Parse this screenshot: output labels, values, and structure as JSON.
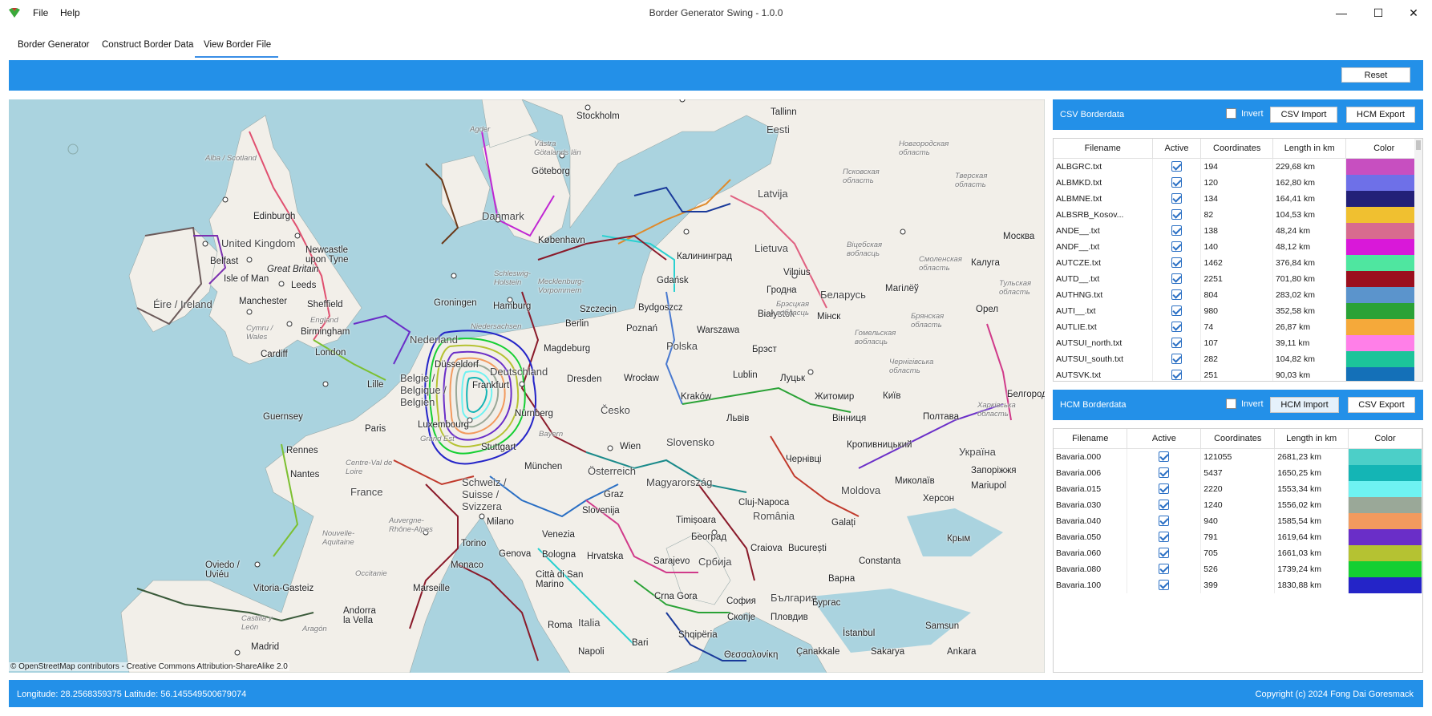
{
  "window": {
    "title": "Border Generator Swing - 1.0.0",
    "menu": [
      "File",
      "Help"
    ],
    "controls": {
      "minimize": "—",
      "maximize": "☐",
      "close": "✕"
    }
  },
  "tabs": [
    {
      "label": "Border Generator",
      "active": false
    },
    {
      "label": "Construct Border Data",
      "active": false
    },
    {
      "label": "View Border File",
      "active": true
    }
  ],
  "toolbar": {
    "reset_label": "Reset"
  },
  "map": {
    "attribution": "© OpenStreetMap contributors - Creative Commons Attribution-ShareAlike 2.0",
    "labels": [
      {
        "text": "Stockholm",
        "cls": ""
      },
      {
        "text": "Tallinn",
        "cls": ""
      },
      {
        "text": "Eesti",
        "cls": "big"
      },
      {
        "text": "Agder",
        "cls": "small"
      },
      {
        "text": "Västra Götalands län",
        "cls": "small"
      },
      {
        "text": "Göteborg",
        "cls": ""
      },
      {
        "text": "Latvija",
        "cls": "big"
      },
      {
        "text": "Псковская область",
        "cls": "small"
      },
      {
        "text": "Новгородская область",
        "cls": "small"
      },
      {
        "text": "Тверская область",
        "cls": "small"
      },
      {
        "text": "Москва",
        "cls": ""
      },
      {
        "text": "Danmark",
        "cls": "big"
      },
      {
        "text": "København",
        "cls": ""
      },
      {
        "text": "Alba / Scotland",
        "cls": "small"
      },
      {
        "text": "Edinburgh",
        "cls": ""
      },
      {
        "text": "United Kingdom",
        "cls": "big"
      },
      {
        "text": "Newcastle upon Tyne",
        "cls": ""
      },
      {
        "text": "Belfast",
        "cls": ""
      },
      {
        "text": "Isle of Man",
        "cls": ""
      },
      {
        "text": "Great Britain",
        "cls": ""
      },
      {
        "text": "Leeds",
        "cls": ""
      },
      {
        "text": "Manchester",
        "cls": ""
      },
      {
        "text": "Sheffield",
        "cls": ""
      },
      {
        "text": "Éire / Ireland",
        "cls": "big"
      },
      {
        "text": "England",
        "cls": "small"
      },
      {
        "text": "Birmingham",
        "cls": ""
      },
      {
        "text": "Cymru / Wales",
        "cls": "small"
      },
      {
        "text": "Cardiff",
        "cls": ""
      },
      {
        "text": "London",
        "cls": ""
      },
      {
        "text": "Hamburg",
        "cls": ""
      },
      {
        "text": "Groningen",
        "cls": ""
      },
      {
        "text": "Schleswig-Holstein",
        "cls": "small"
      },
      {
        "text": "Mecklenburg-Vorpommern",
        "cls": "small"
      },
      {
        "text": "Калининград",
        "cls": ""
      },
      {
        "text": "Lietuva",
        "cls": "big"
      },
      {
        "text": "Vilnius",
        "cls": ""
      },
      {
        "text": "Вiцебская вобласць",
        "cls": "small"
      },
      {
        "text": "Смоленская область",
        "cls": "small"
      },
      {
        "text": "Калуга",
        "cls": ""
      },
      {
        "text": "Gdańsk",
        "cls": ""
      },
      {
        "text": "Bydgoszcz",
        "cls": ""
      },
      {
        "text": "Szczecin",
        "cls": ""
      },
      {
        "text": "Niedersachsen",
        "cls": "small"
      },
      {
        "text": "Nederland",
        "cls": "big"
      },
      {
        "text": "Berlin",
        "cls": ""
      },
      {
        "text": "Poznań",
        "cls": ""
      },
      {
        "text": "Warszawa",
        "cls": ""
      },
      {
        "text": "Białystok",
        "cls": ""
      },
      {
        "text": "Гродна",
        "cls": ""
      },
      {
        "text": "Беларусь",
        "cls": "big"
      },
      {
        "text": "Мінск",
        "cls": ""
      },
      {
        "text": "Магілёў",
        "cls": ""
      },
      {
        "text": "Брянская область",
        "cls": "small"
      },
      {
        "text": "Тульская область",
        "cls": "small"
      },
      {
        "text": "Орел",
        "cls": ""
      },
      {
        "text": "Magdeburg",
        "cls": ""
      },
      {
        "text": "Polska",
        "cls": "big"
      },
      {
        "text": "Брэсцкая вобласць",
        "cls": "small"
      },
      {
        "text": "Гомельская вобласць",
        "cls": "small"
      },
      {
        "text": "Брэст",
        "cls": ""
      },
      {
        "text": "Düsseldorf",
        "cls": ""
      },
      {
        "text": "Deutschland",
        "cls": "big"
      },
      {
        "text": "Dresden",
        "cls": ""
      },
      {
        "text": "Wrocław",
        "cls": ""
      },
      {
        "text": "Lublin",
        "cls": ""
      },
      {
        "text": "Луцьк",
        "cls": ""
      },
      {
        "text": "Чернігівська область",
        "cls": "small"
      },
      {
        "text": "Belgie / Belgique / Belgien",
        "cls": "big"
      },
      {
        "text": "Lille",
        "cls": ""
      },
      {
        "text": "Frankfurt",
        "cls": ""
      },
      {
        "text": "Česko",
        "cls": "big"
      },
      {
        "text": "Kraków",
        "cls": ""
      },
      {
        "text": "Житомир",
        "cls": ""
      },
      {
        "text": "Київ",
        "cls": ""
      },
      {
        "text": "Белгород",
        "cls": ""
      },
      {
        "text": "Guernsey",
        "cls": ""
      },
      {
        "text": "Nürnberg",
        "cls": ""
      },
      {
        "text": "Львів",
        "cls": ""
      },
      {
        "text": "Вінниця",
        "cls": ""
      },
      {
        "text": "Полтава",
        "cls": ""
      },
      {
        "text": "Харківська область",
        "cls": "small"
      },
      {
        "text": "Paris",
        "cls": ""
      },
      {
        "text": "Luxembourg",
        "cls": ""
      },
      {
        "text": "Bayern",
        "cls": "small"
      },
      {
        "text": "Grand Est",
        "cls": "small"
      },
      {
        "text": "Slovensko",
        "cls": "big"
      },
      {
        "text": "Кропивницький",
        "cls": ""
      },
      {
        "text": "Україна",
        "cls": "big"
      },
      {
        "text": "Rennes",
        "cls": ""
      },
      {
        "text": "Wien",
        "cls": ""
      },
      {
        "text": "Stuttgart",
        "cls": ""
      },
      {
        "text": "München",
        "cls": ""
      },
      {
        "text": "Чернівці",
        "cls": ""
      },
      {
        "text": "Österreich",
        "cls": "big"
      },
      {
        "text": "Magyarország",
        "cls": "big"
      },
      {
        "text": "Nantes",
        "cls": ""
      },
      {
        "text": "Centre-Val de Loire",
        "cls": "small"
      },
      {
        "text": "Schweiz / Suisse / Svizzera",
        "cls": "big"
      },
      {
        "text": "Миколаїв",
        "cls": ""
      },
      {
        "text": "Запоріжжя",
        "cls": ""
      },
      {
        "text": "France",
        "cls": "big"
      },
      {
        "text": "Graz",
        "cls": ""
      },
      {
        "text": "Cluj-Napoca",
        "cls": ""
      },
      {
        "text": "Moldova",
        "cls": "big"
      },
      {
        "text": "Херсон",
        "cls": ""
      },
      {
        "text": "Mariupol",
        "cls": ""
      },
      {
        "text": "Slovenija",
        "cls": ""
      },
      {
        "text": "România",
        "cls": "big"
      },
      {
        "text": "Milano",
        "cls": ""
      },
      {
        "text": "Auvergne-Rhône-Alpes",
        "cls": "small"
      },
      {
        "text": "Nouvelle-Aquitaine",
        "cls": "small"
      },
      {
        "text": "Timișoara",
        "cls": ""
      },
      {
        "text": "Galați",
        "cls": ""
      },
      {
        "text": "Venezia",
        "cls": ""
      },
      {
        "text": "Torino",
        "cls": ""
      },
      {
        "text": "Београд",
        "cls": ""
      },
      {
        "text": "Genova",
        "cls": ""
      },
      {
        "text": "Bologna",
        "cls": ""
      },
      {
        "text": "Hrvatska",
        "cls": ""
      },
      {
        "text": "Craiova",
        "cls": ""
      },
      {
        "text": "București",
        "cls": ""
      },
      {
        "text": "Constanta",
        "cls": ""
      },
      {
        "text": "Крым",
        "cls": ""
      },
      {
        "text": "Oviedo / Uviéu",
        "cls": ""
      },
      {
        "text": "Monaco",
        "cls": ""
      },
      {
        "text": "Sarajevo",
        "cls": ""
      },
      {
        "text": "Србија",
        "cls": "big"
      },
      {
        "text": "Occitanie",
        "cls": "small"
      },
      {
        "text": "Città di San Marino",
        "cls": ""
      },
      {
        "text": "Vitoria-Gasteiz",
        "cls": ""
      },
      {
        "text": "Marseille",
        "cls": ""
      },
      {
        "text": "Варна",
        "cls": ""
      },
      {
        "text": "София",
        "cls": ""
      },
      {
        "text": "България",
        "cls": "big"
      },
      {
        "text": "Crna Gora",
        "cls": ""
      },
      {
        "text": "Бургас",
        "cls": ""
      },
      {
        "text": "Andorra la Vella",
        "cls": ""
      },
      {
        "text": "Castilla y León",
        "cls": "small"
      },
      {
        "text": "Aragón",
        "cls": "small"
      },
      {
        "text": "Italia",
        "cls": "big"
      },
      {
        "text": "Roma",
        "cls": ""
      },
      {
        "text": "Скопје",
        "cls": ""
      },
      {
        "text": "Пловдив",
        "cls": ""
      },
      {
        "text": "Samsun",
        "cls": ""
      },
      {
        "text": "İstanbul",
        "cls": ""
      },
      {
        "text": "Madrid",
        "cls": ""
      },
      {
        "text": "Shqipëria",
        "cls": ""
      },
      {
        "text": "Napoli",
        "cls": ""
      },
      {
        "text": "Bari",
        "cls": ""
      },
      {
        "text": "Θεσσαλονίκη",
        "cls": ""
      },
      {
        "text": "Çanakkale",
        "cls": ""
      },
      {
        "text": "Sakarya",
        "cls": ""
      },
      {
        "text": "Ankara",
        "cls": ""
      }
    ]
  },
  "csv_panel": {
    "title": "CSV Borderdata",
    "invert_label": "Invert",
    "import_label": "CSV Import",
    "export_label": "HCM Export",
    "columns": [
      "Filename",
      "Active",
      "Coordinates",
      "Length in km",
      "Color"
    ],
    "rows": [
      {
        "filename": "ALBGRC.txt",
        "coordinates": "194",
        "length": "229,68 km",
        "color": "#c74fc0"
      },
      {
        "filename": "ALBMKD.txt",
        "coordinates": "120",
        "length": "162,80 km",
        "color": "#6e70e8"
      },
      {
        "filename": "ALBMNE.txt",
        "coordinates": "134",
        "length": "164,41 km",
        "color": "#232078"
      },
      {
        "filename": "ALBSRB_Kosov...",
        "coordinates": "82",
        "length": "104,53 km",
        "color": "#f0c030"
      },
      {
        "filename": "ANDE__.txt",
        "coordinates": "138",
        "length": "48,24 km",
        "color": "#d86b8e"
      },
      {
        "filename": "ANDF__.txt",
        "coordinates": "140",
        "length": "48,12 km",
        "color": "#d918d9"
      },
      {
        "filename": "AUTCZE.txt",
        "coordinates": "1462",
        "length": "376,84 km",
        "color": "#4fe6a0"
      },
      {
        "filename": "AUTD__.txt",
        "coordinates": "2251",
        "length": "701,80 km",
        "color": "#9b0f1e"
      },
      {
        "filename": "AUTHNG.txt",
        "coordinates": "804",
        "length": "283,02 km",
        "color": "#5b94cc"
      },
      {
        "filename": "AUTI__.txt",
        "coordinates": "980",
        "length": "352,58 km",
        "color": "#2aa236"
      },
      {
        "filename": "AUTLIE.txt",
        "coordinates": "74",
        "length": "26,87 km",
        "color": "#f5a93a"
      },
      {
        "filename": "AUTSUI_north.txt",
        "coordinates": "107",
        "length": "39,11 km",
        "color": "#ff7fe8"
      },
      {
        "filename": "AUTSUI_south.txt",
        "coordinates": "282",
        "length": "104,82 km",
        "color": "#1cc49a"
      },
      {
        "filename": "AUTSVK.txt",
        "coordinates": "251",
        "length": "90,03 km",
        "color": "#1470b8"
      }
    ]
  },
  "hcm_panel": {
    "title": "HCM Borderdata",
    "invert_label": "Invert",
    "import_label": "HCM Import",
    "export_label": "CSV Export",
    "columns": [
      "Filename",
      "Active",
      "Coordinates",
      "Length in km",
      "Color"
    ],
    "rows": [
      {
        "filename": "Bavaria.000",
        "coordinates": "121055",
        "length": "2681,23 km",
        "color": "#4ccfc8"
      },
      {
        "filename": "Bavaria.006",
        "coordinates": "5437",
        "length": "1650,25 km",
        "color": "#14b5b5"
      },
      {
        "filename": "Bavaria.015",
        "coordinates": "2220",
        "length": "1553,34 km",
        "color": "#6ef2f2"
      },
      {
        "filename": "Bavaria.030",
        "coordinates": "1240",
        "length": "1556,02 km",
        "color": "#9aa898"
      },
      {
        "filename": "Bavaria.040",
        "coordinates": "940",
        "length": "1585,54 km",
        "color": "#f29a5e"
      },
      {
        "filename": "Bavaria.050",
        "coordinates": "791",
        "length": "1619,64 km",
        "color": "#6a2ec8"
      },
      {
        "filename": "Bavaria.060",
        "coordinates": "705",
        "length": "1661,03 km",
        "color": "#b5c232"
      },
      {
        "filename": "Bavaria.080",
        "coordinates": "526",
        "length": "1739,24 km",
        "color": "#14cf32"
      },
      {
        "filename": "Bavaria.100",
        "coordinates": "399",
        "length": "1830,88 km",
        "color": "#2424c8"
      }
    ]
  },
  "status": {
    "coordinates": "Longitude: 28.2568359375 Latitude: 56.145549500679074",
    "copyright": "Copyright (c) 2024 Fong Dai Goresmack"
  }
}
